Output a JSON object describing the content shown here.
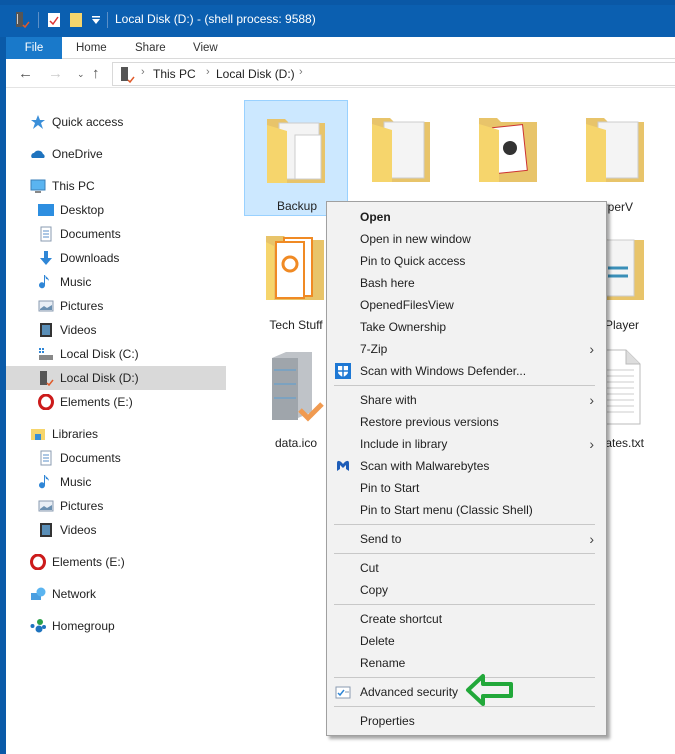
{
  "window": {
    "title": "Local Disk (D:) - (shell process: 9588)",
    "quick_access_toolbar": [
      "drive-icon",
      "properties-icon",
      "new-folder-icon",
      "customize-dropdown-icon"
    ]
  },
  "ribbon": {
    "tabs": [
      {
        "label": "File",
        "active": true
      },
      {
        "label": "Home"
      },
      {
        "label": "Share"
      },
      {
        "label": "View"
      }
    ]
  },
  "address_bar": {
    "breadcrumbs": [
      "This PC",
      "Local Disk (D:)"
    ]
  },
  "nav_pane": {
    "items": [
      {
        "label": "Quick access",
        "icon": "star-icon",
        "level": 0
      },
      {
        "label": "OneDrive",
        "icon": "cloud-icon",
        "level": 0
      },
      {
        "label": "This PC",
        "icon": "computer-icon",
        "level": 0
      },
      {
        "label": "Desktop",
        "icon": "desktop-icon",
        "level": 1
      },
      {
        "label": "Documents",
        "icon": "documents-icon",
        "level": 1
      },
      {
        "label": "Downloads",
        "icon": "downloads-icon",
        "level": 1
      },
      {
        "label": "Music",
        "icon": "music-icon",
        "level": 1
      },
      {
        "label": "Pictures",
        "icon": "pictures-icon",
        "level": 1
      },
      {
        "label": "Videos",
        "icon": "videos-icon",
        "level": 1
      },
      {
        "label": "Local Disk (C:)",
        "icon": "drive-c-icon",
        "level": 1
      },
      {
        "label": "Local Disk (D:)",
        "icon": "drive-d-icon",
        "level": 1,
        "selected": true
      },
      {
        "label": "Elements (E:)",
        "icon": "opera-drive-icon",
        "level": 1
      },
      {
        "label": "Libraries",
        "icon": "libraries-icon",
        "level": 0
      },
      {
        "label": "Documents",
        "icon": "documents-icon",
        "level": 1
      },
      {
        "label": "Music",
        "icon": "music-icon",
        "level": 1
      },
      {
        "label": "Pictures",
        "icon": "pictures-icon",
        "level": 1
      },
      {
        "label": "Videos",
        "icon": "videos-icon",
        "level": 1
      },
      {
        "label": "Elements (E:)",
        "icon": "opera-drive-icon",
        "level": 0
      },
      {
        "label": "Network",
        "icon": "network-icon",
        "level": 0
      },
      {
        "label": "Homegroup",
        "icon": "homegroup-icon",
        "level": 0
      }
    ]
  },
  "files": [
    {
      "name": "Backup",
      "type": "folder",
      "selected": true
    },
    {
      "name": "",
      "type": "folder"
    },
    {
      "name": "",
      "type": "folder-cards"
    },
    {
      "name": "HyperV",
      "type": "folder",
      "visible_label": "lyperV"
    },
    {
      "name": "Tech Stuff",
      "type": "folder-pdf"
    },
    {
      "name": "C Player",
      "type": "folder-media",
      "visible_label": "C Player"
    },
    {
      "name": "data.ico",
      "type": "server-icon"
    },
    {
      "name": "ai-rates.txt",
      "type": "text-file",
      "visible_label": "ai-rates.txt"
    }
  ],
  "context_menu": {
    "groups": [
      [
        {
          "label": "Open",
          "bold": true
        },
        {
          "label": "Open in new window"
        },
        {
          "label": "Pin to Quick access"
        },
        {
          "label": "Bash here"
        },
        {
          "label": "OpenedFilesView"
        },
        {
          "label": "Take Ownership"
        },
        {
          "label": "7-Zip",
          "submenu": true
        },
        {
          "label": "Scan with Windows Defender...",
          "icon": "windows-defender-icon"
        }
      ],
      [
        {
          "label": "Share with",
          "submenu": true
        },
        {
          "label": "Restore previous versions"
        },
        {
          "label": "Include in library",
          "submenu": true
        },
        {
          "label": "Scan with Malwarebytes",
          "icon": "malwarebytes-icon"
        },
        {
          "label": "Pin to Start"
        },
        {
          "label": "Pin to Start menu (Classic Shell)"
        }
      ],
      [
        {
          "label": "Send to",
          "submenu": true
        }
      ],
      [
        {
          "label": "Cut"
        },
        {
          "label": "Copy"
        }
      ],
      [
        {
          "label": "Create shortcut"
        },
        {
          "label": "Delete"
        },
        {
          "label": "Rename"
        }
      ],
      [
        {
          "label": "Advanced security",
          "icon": "security-checkbox-icon",
          "highlighted_by_arrow": true
        }
      ],
      [
        {
          "label": "Properties"
        }
      ]
    ]
  },
  "annotation": {
    "type": "arrow",
    "direction": "left",
    "color": "#22a83a",
    "points_to": "Advanced security"
  },
  "colors": {
    "titlebar": "#0b5fb0",
    "file_tab": "#1979ca",
    "selection": "#cce8ff",
    "menu_bg": "#f2f2f2"
  }
}
